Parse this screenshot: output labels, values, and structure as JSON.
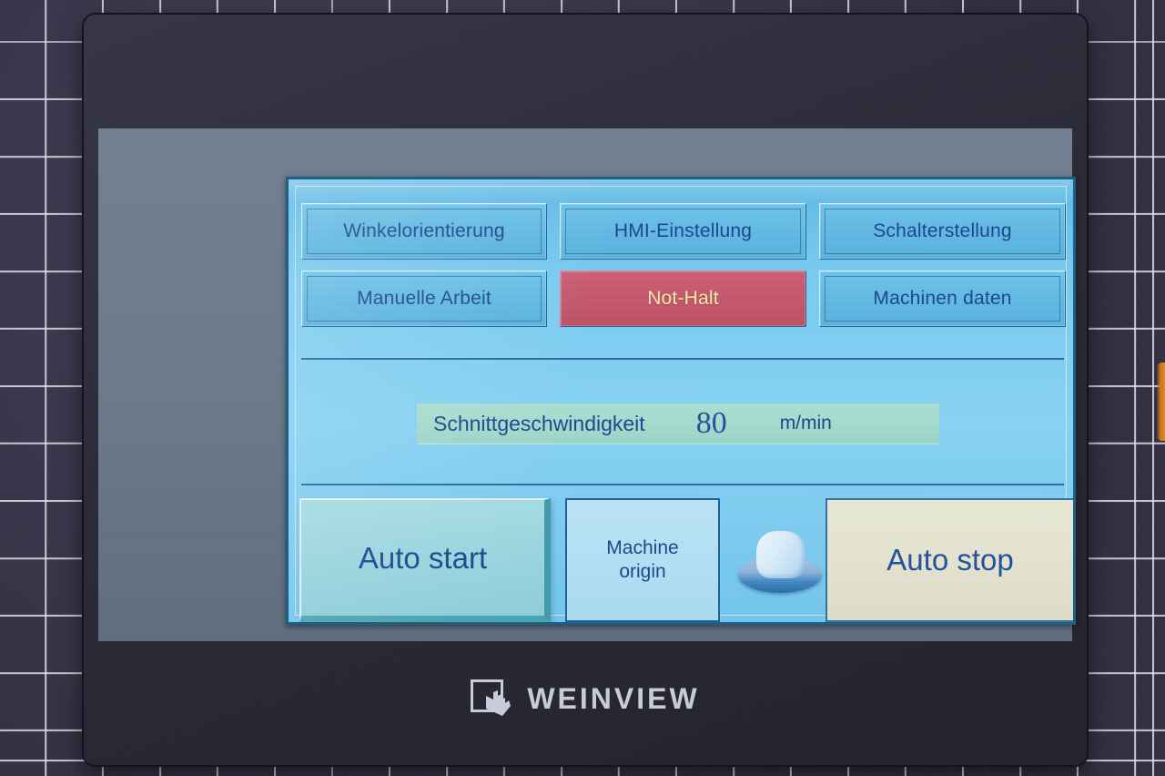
{
  "device": {
    "brand": "WEINVIEW",
    "logo_icon": "touch-hand-square-icon"
  },
  "screen": {
    "menu_buttons": [
      {
        "label": "Winkelorientierung",
        "style": "normal"
      },
      {
        "label": "HMI-Einstellung",
        "style": "normal"
      },
      {
        "label": "Schalterstellung",
        "style": "normal"
      },
      {
        "label": "Manuelle Arbeit",
        "style": "normal"
      },
      {
        "label": "Not-Halt",
        "style": "danger"
      },
      {
        "label": "Machinen daten",
        "style": "normal"
      }
    ],
    "speed": {
      "label": "Schnittgeschwindigkeit",
      "value": "80",
      "unit": "m/min"
    },
    "actions": {
      "auto_start": "Auto start",
      "machine_origin_line1": "Machine",
      "machine_origin_line2": "origin",
      "pushbutton_icon": "pushbutton-knob-icon",
      "auto_stop": "Auto stop"
    }
  },
  "colors": {
    "screen_blue": "#79ccf2",
    "button_blue": "#5fb9e4",
    "text_blue": "#17458c",
    "danger_red": "#c4556c",
    "danger_text": "#eff0a6",
    "speed_bar_green": "#a3dbcd",
    "auto_start_teal": "#9ad6e0",
    "auto_stop_cream": "#e4e4d0",
    "bezel_dark": "#2b2b38",
    "bezel_grey": "#6c7a8b",
    "logo_grey": "#c9ccd8",
    "mat_purple": "#3e3950",
    "accent_orange": "#e8871f"
  }
}
